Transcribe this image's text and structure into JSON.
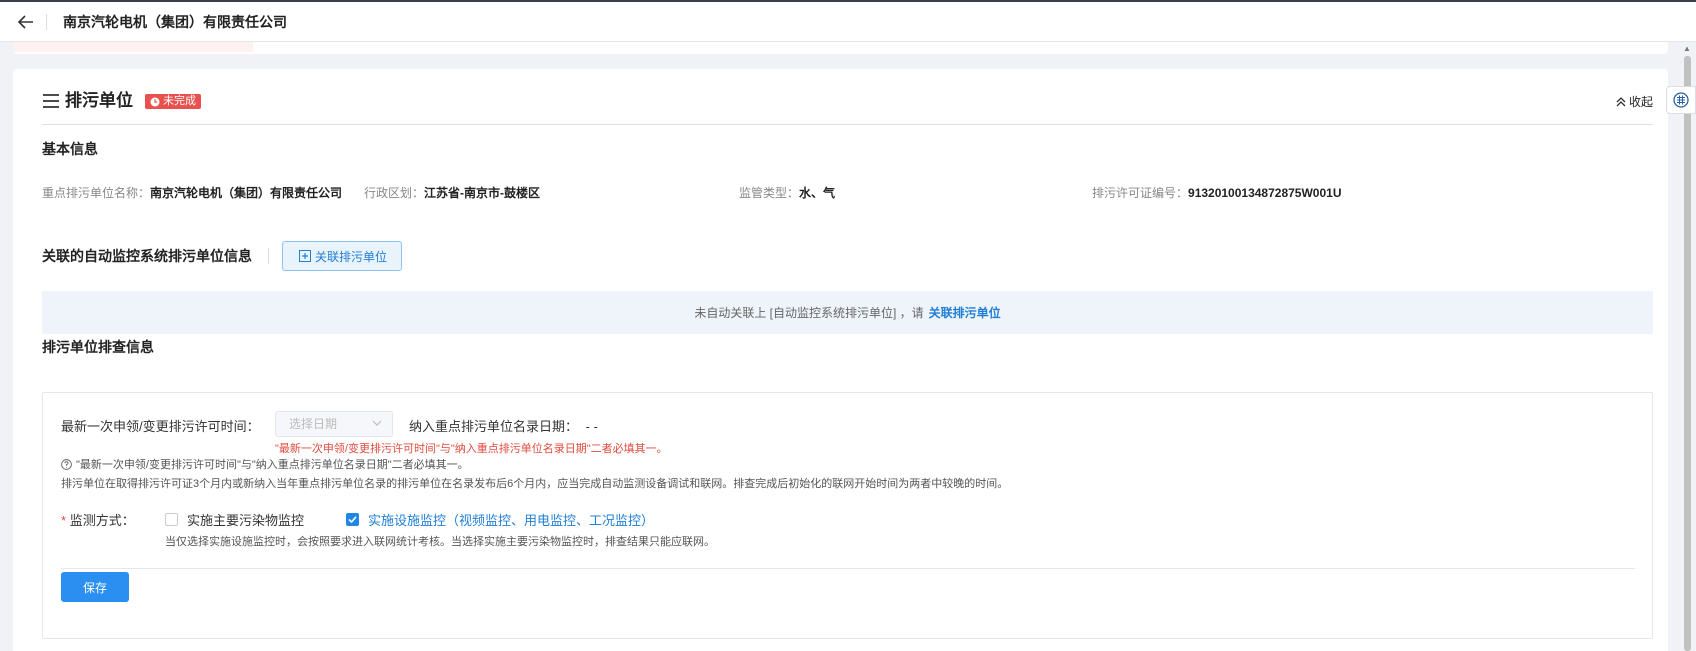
{
  "header": {
    "back_icon": "arrow-left-icon",
    "title": "南京汽轮电机（集团）有限责任公司"
  },
  "section": {
    "title": "排污单位",
    "status_badge": "未完成",
    "status_color": "#e8514d",
    "collapse_label": "收起"
  },
  "basic_info": {
    "heading": "基本信息",
    "fields": [
      {
        "label": "重点排污单位名称：",
        "value": "南京汽轮电机（集团）有限责任公司"
      },
      {
        "label": "行政区划：",
        "value": "江苏省-南京市-鼓楼区"
      },
      {
        "label": "监管类型：",
        "value": "水、气"
      },
      {
        "label": "排污许可证编号：",
        "value": "91320100134872875W001U"
      }
    ]
  },
  "linked": {
    "heading": "关联的自动监控系统排污单位信息",
    "button_label": "关联排污单位",
    "notice_text": "未自动关联上 [自动监控系统排污单位] ，请",
    "notice_link": "关联排污单位"
  },
  "inspection": {
    "heading": "排污单位排查信息",
    "latest_permit_label": "最新一次申领/变更排污许可时间：",
    "date_placeholder": "选择日期",
    "listing_date_label": "纳入重点排污单位名录日期：",
    "listing_date_value": "- -",
    "error_text": "\"最新一次申领/变更排污许可时间\"与\"纳入重点排污单位名录日期\"二者必填其一。",
    "tip_line1": "\"最新一次申领/变更排污许可时间\"与\"纳入重点排污单位名录日期\"二者必填其一。",
    "tip_line2": "排污单位在取得排污许可证3个月内或新纳入当年重点排污单位名录的排污单位在名录发布后6个月内，应当完成自动监测设备调试和联网。排查完成后初始化的联网开始时间为两者中较晚的时间。",
    "required_mark": "*",
    "monitor_label": "监测方式：",
    "option1": {
      "label": "实施主要污染物监控",
      "checked": false
    },
    "option2": {
      "label": "实施设施监控（视频监控、用电监控、工况监控）",
      "checked": true
    },
    "hint": "当仅选择实施设施监控时，会按照要求进入联网统计考核。当选择实施主要污染物监控时，排查结果只能应联网。",
    "save_label": "保存"
  },
  "colors": {
    "primary": "#2a8ff0",
    "link": "#1f7ed6",
    "error": "#e04b3d"
  }
}
